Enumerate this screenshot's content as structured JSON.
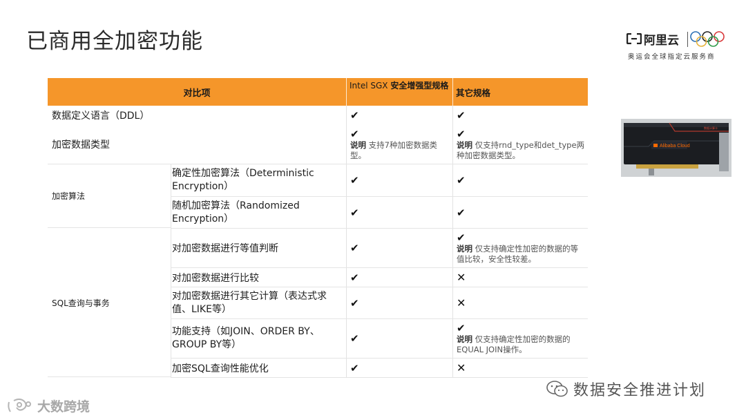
{
  "slide": {
    "title": "已商用全加密功能"
  },
  "logo": {
    "brand": "阿里云",
    "tagline": "奥运会全球指定云服务商"
  },
  "table": {
    "header": {
      "col1": "对比项",
      "col2_light": "Intel SGX ",
      "col2_bold": "安全增强型规格",
      "col3": "其它规格"
    },
    "rows": {
      "ddl": {
        "label": "数据定义语言（DDL）",
        "sgx": "✔",
        "other": "✔"
      },
      "types": {
        "label": "加密数据类型",
        "sgx_mark": "✔",
        "sgx_note_label": "说明",
        "sgx_note": " 支持7种加密数据类型。",
        "other_mark": "✔",
        "other_note_label": "说明",
        "other_note": " 仅支持rnd_type和det_type两种加密数据类型。"
      },
      "algo_group": "加密算法",
      "det": {
        "label": "确定性加密算法（Deterministic Encryption）",
        "sgx": "✔",
        "other": "✔"
      },
      "rnd": {
        "label": "随机加密算法（Randomized Encryption）",
        "sgx": "✔",
        "other": "✔"
      },
      "sql_group": "SQL查询与事务",
      "eq": {
        "label": "对加密数据进行等值判断",
        "sgx": "✔",
        "other_mark": "✔",
        "other_note_label": "说明",
        "other_note": " 仅支持确定性加密的数据的等值比较，安全性较差。"
      },
      "cmp": {
        "label": "对加密数据进行比较",
        "sgx": "✔",
        "other": "✕"
      },
      "calc": {
        "label": "对加密数据进行其它计算（表达式求值、LIKE等）",
        "sgx": "✔",
        "other": "✕"
      },
      "join": {
        "label": "功能支持（如JOIN、ORDER BY、GROUP BY等）",
        "sgx": "✔",
        "other_mark": "✔",
        "other_note_label": "说明",
        "other_note": " 仅支持确定性加密的数据的EQUAL JOIN操作。"
      },
      "opt": {
        "label": "加密SQL查询性能优化",
        "sgx": "✔",
        "other": "✕"
      }
    }
  },
  "gpu_card": {
    "label": "Alibaba Cloud",
    "small": "数据计算卡"
  },
  "watermark": {
    "text": "数据安全推进计划"
  },
  "corner_mark": {
    "text": "大数跨境"
  },
  "colors": {
    "header": "#f5962a"
  }
}
